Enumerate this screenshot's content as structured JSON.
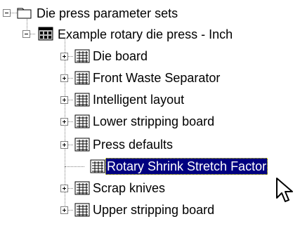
{
  "tree": {
    "root": {
      "label": "Die press parameter sets",
      "icon": "folder-icon",
      "expanded": true
    },
    "parameter_set": {
      "label": "Example rotary die press - Inch",
      "icon": "parameter-set-icon",
      "expanded": true
    },
    "children": [
      {
        "label": "Die board",
        "icon": "parameter-group-icon",
        "expandable": true,
        "selected": false
      },
      {
        "label": "Front Waste Separator",
        "icon": "parameter-group-icon",
        "expandable": true,
        "selected": false
      },
      {
        "label": "Intelligent layout",
        "icon": "parameter-group-icon",
        "expandable": true,
        "selected": false
      },
      {
        "label": "Lower stripping board",
        "icon": "parameter-group-icon",
        "expandable": true,
        "selected": false
      },
      {
        "label": "Press defaults",
        "icon": "parameter-group-icon",
        "expandable": true,
        "selected": false
      },
      {
        "label": "Rotary Shrink Stretch Factor",
        "icon": "parameter-group-icon",
        "expandable": false,
        "selected": true
      },
      {
        "label": "Scrap knives",
        "icon": "parameter-group-icon",
        "expandable": true,
        "selected": false
      },
      {
        "label": "Upper stripping board",
        "icon": "parameter-group-icon",
        "expandable": true,
        "selected": false
      }
    ]
  },
  "colors": {
    "selection_background": "#000080",
    "selection_text": "#ffffff",
    "connector": "#808080"
  },
  "cursor": "arrow-pointer-icon"
}
